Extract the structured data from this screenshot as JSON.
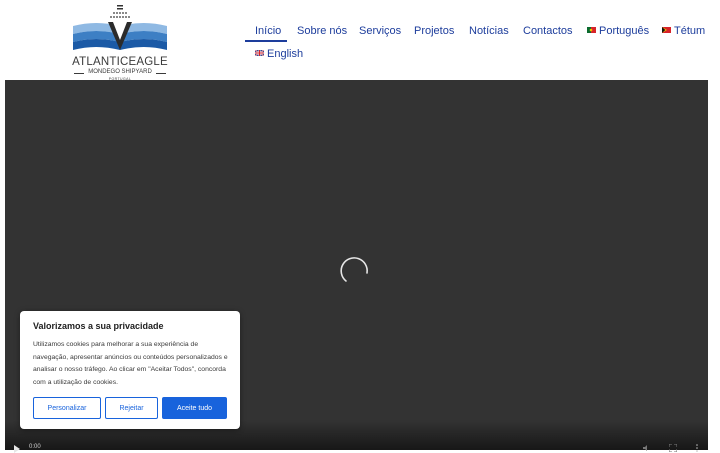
{
  "brand": {
    "name": "ATLANTICEAGLE",
    "subtitle": "MONDEGO SHIPYARD",
    "country": "PORTUGAL"
  },
  "nav": {
    "items": [
      {
        "label": "Início",
        "active": true
      },
      {
        "label": "Sobre nós"
      },
      {
        "label": "Serviços"
      },
      {
        "label": "Projetos"
      },
      {
        "label": "Notícias"
      },
      {
        "label": "Contactos"
      }
    ],
    "languages": [
      {
        "label": "Português",
        "flag": "portugal-flag"
      },
      {
        "label": "Tétum",
        "flag": "east-timor-flag"
      },
      {
        "label": "English",
        "flag": "uk-flag"
      }
    ]
  },
  "video": {
    "time": "0:00",
    "state": "loading"
  },
  "cookie": {
    "title": "Valorizamos a sua privacidade",
    "text": "Utilizamos cookies para melhorar a sua experiência de navegação, apresentar anúncios ou conteúdos personalizados e analisar o nosso tráfego. Ao clicar em \"Aceitar Todos\", concorda com a utilização de cookies.",
    "customize_label": "Personalizar",
    "reject_label": "Rejeitar",
    "accept_label": "Aceite tudo"
  },
  "colors": {
    "nav_text": "#1d3d9c",
    "accent_button": "#1863dc",
    "video_background": "#333333",
    "logo_waves": "#3d7fc4"
  }
}
